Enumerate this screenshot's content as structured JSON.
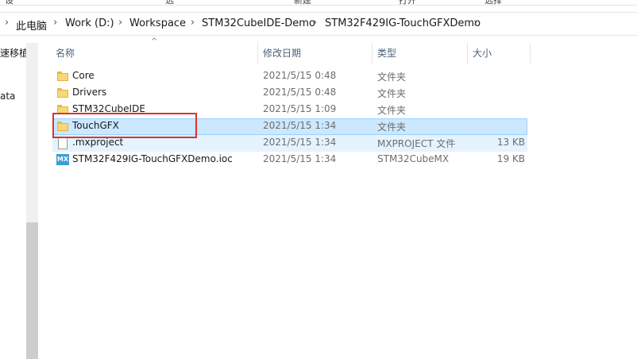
{
  "ribbon": {
    "labels": [
      "设",
      "选",
      "新建",
      "打开",
      "选择"
    ]
  },
  "breadcrumb": {
    "items": [
      "此电脑",
      "Work (D:)",
      "Workspace",
      "STM32CubeIDE-Demo",
      "STM32F429IG-TouchGFXDemo"
    ]
  },
  "nav": {
    "items": [
      "速移植",
      "ata"
    ]
  },
  "columns": {
    "name": "名称",
    "date": "修改日期",
    "type": "类型",
    "size": "大小"
  },
  "files": [
    {
      "name": "Core",
      "date": "2021/5/15 0:48",
      "type": "文件夹",
      "size": "",
      "icon": "folder-icon"
    },
    {
      "name": "Drivers",
      "date": "2021/5/15 0:48",
      "type": "文件夹",
      "size": "",
      "icon": "folder-icon"
    },
    {
      "name": "STM32CubeIDE",
      "date": "2021/5/15 1:09",
      "type": "文件夹",
      "size": "",
      "icon": "folder-icon"
    },
    {
      "name": "TouchGFX",
      "date": "2021/5/15 1:34",
      "type": "文件夹",
      "size": "",
      "icon": "folder-icon",
      "selected": true
    },
    {
      "name": ".mxproject",
      "date": "2021/5/15 1:34",
      "type": "MXPROJECT 文件",
      "size": "13 KB",
      "icon": "file-icon"
    },
    {
      "name": "STM32F429IG-TouchGFXDemo.ioc",
      "date": "2021/5/15 1:34",
      "type": "STM32CubeMX",
      "size": "19 KB",
      "icon": "mx-icon"
    }
  ],
  "mx_icon_text": "MX",
  "colors": {
    "selection": "#cce8ff",
    "highlight_box": "#e03030",
    "folder": "#f8d775"
  }
}
